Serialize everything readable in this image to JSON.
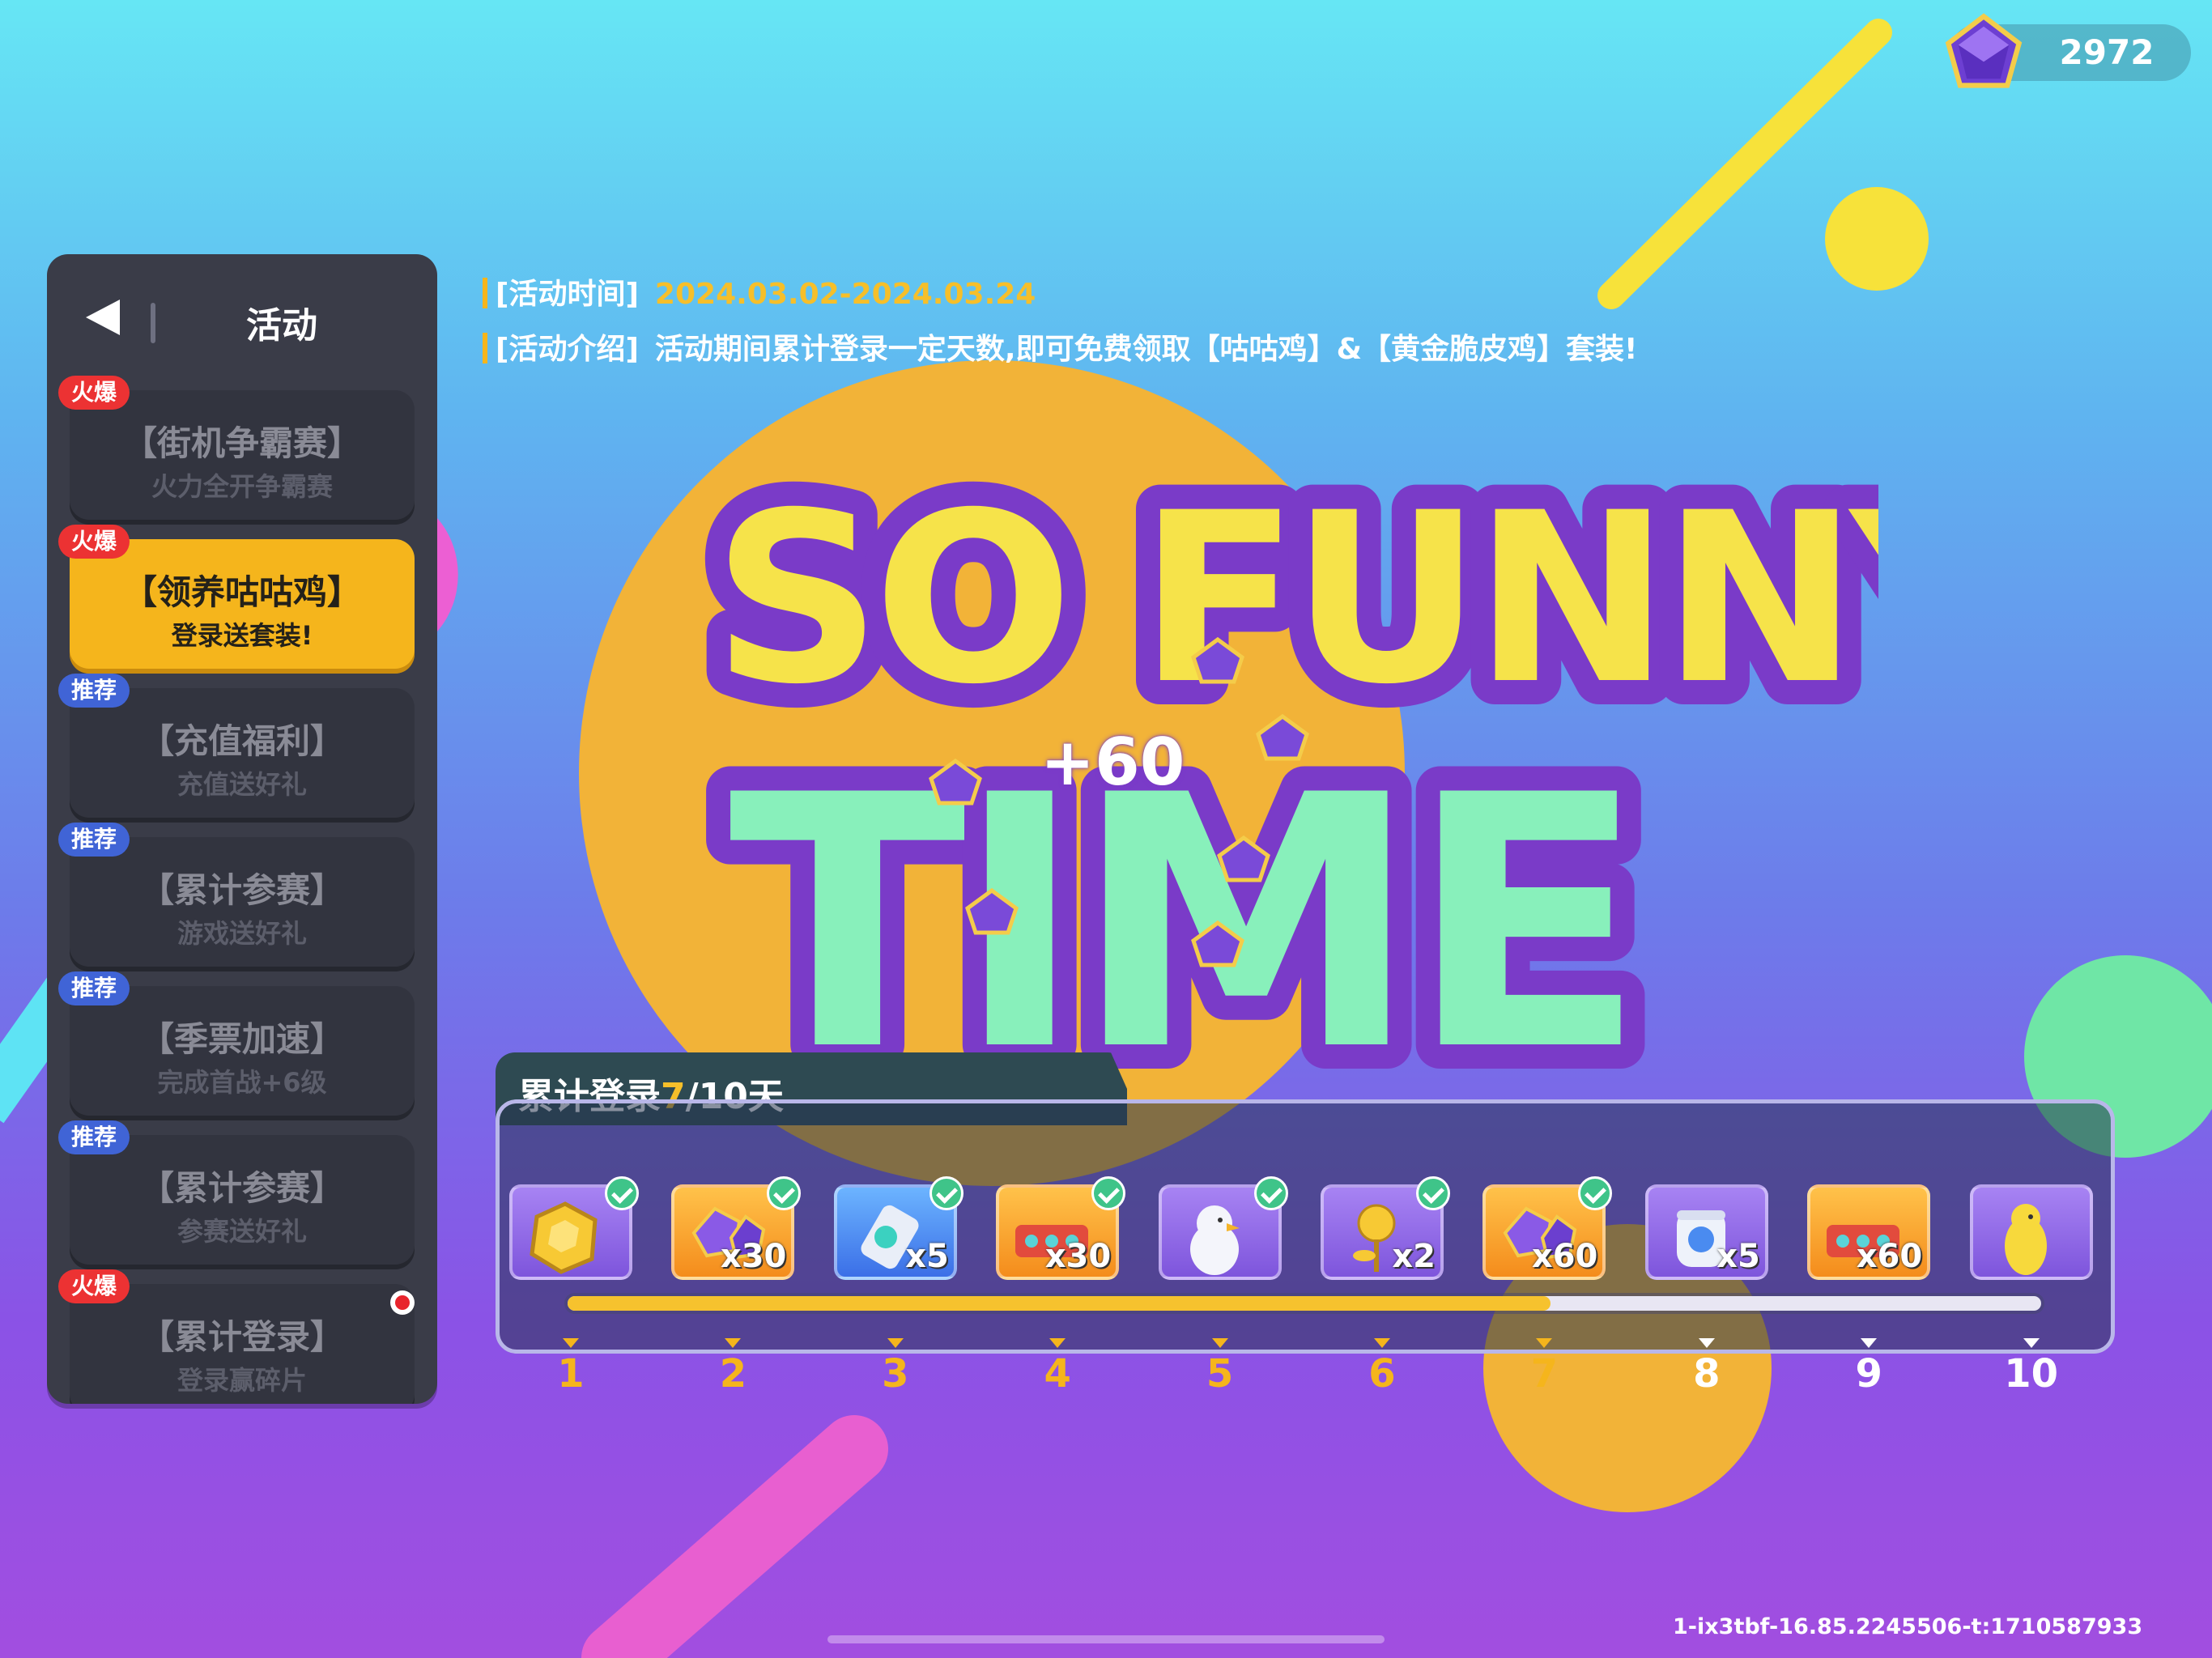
{
  "currency": {
    "icon": "purple-gem-icon",
    "amount": "2972"
  },
  "sidebar": {
    "title": "活动",
    "items": [
      {
        "badge": "火爆",
        "badge_type": "hot",
        "title": "【街机争霸赛】",
        "subtitle": "火力全开争霸赛",
        "active": false
      },
      {
        "badge": "火爆",
        "badge_type": "hot",
        "title": "【领养咕咕鸡】",
        "subtitle": "登录送套装!",
        "active": true
      },
      {
        "badge": "推荐",
        "badge_type": "rec",
        "title": "【充值福利】",
        "subtitle": "充值送好礼",
        "active": false
      },
      {
        "badge": "推荐",
        "badge_type": "rec",
        "title": "【累计参赛】",
        "subtitle": "游戏送好礼",
        "active": false
      },
      {
        "badge": "推荐",
        "badge_type": "rec",
        "title": "【季票加速】",
        "subtitle": "完成首战+6级",
        "active": false
      },
      {
        "badge": "推荐",
        "badge_type": "rec",
        "title": "【累计参赛】",
        "subtitle": "参赛送好礼",
        "active": false
      },
      {
        "badge": "火爆",
        "badge_type": "hot",
        "title": "【累计登录】",
        "subtitle": "登录赢碎片",
        "active": false
      }
    ]
  },
  "event": {
    "time_label": "[活动时间]",
    "time_value": "2024.03.02-2024.03.24",
    "intro_label": "[活动介绍]",
    "intro_value": "活动期间累计登录一定天数,即可免费领取【咕咕鸡】&【黄金脆皮鸡】套装!"
  },
  "banner": {
    "line1": "SO FUNNY",
    "line2": "TIME",
    "popup": "+60"
  },
  "progress": {
    "title_prefix": "累计登录",
    "current": "7",
    "title_suffix": "/10天",
    "fraction": 0.667,
    "rewards": [
      {
        "day": "1",
        "icon": "gold-coin-icon",
        "qty": "",
        "style": "purple",
        "claimed": true
      },
      {
        "day": "2",
        "icon": "purple-gem-pile-icon",
        "qty": "x30",
        "style": "orange",
        "claimed": true
      },
      {
        "day": "3",
        "icon": "paint-tube-icon",
        "qty": "x5",
        "style": "blue",
        "claimed": true
      },
      {
        "day": "4",
        "icon": "ticket-pile-icon",
        "qty": "x30",
        "style": "orange",
        "claimed": true
      },
      {
        "day": "5",
        "icon": "white-chicken-icon",
        "qty": "",
        "style": "purple",
        "claimed": true
      },
      {
        "day": "6",
        "icon": "golden-rose-icon",
        "qty": "x2",
        "style": "purple",
        "claimed": true
      },
      {
        "day": "7",
        "icon": "purple-gem-pile-icon",
        "qty": "x60",
        "style": "orange",
        "claimed": true
      },
      {
        "day": "8",
        "icon": "paint-jar-icon",
        "qty": "x5",
        "style": "purple",
        "claimed": false
      },
      {
        "day": "9",
        "icon": "ticket-pile-icon",
        "qty": "x60",
        "style": "orange",
        "claimed": false
      },
      {
        "day": "10",
        "icon": "golden-chicken-icon",
        "qty": "",
        "style": "purple",
        "claimed": false
      }
    ]
  },
  "footer": {
    "build_info": "1-ix3tbf-16.85.2245506-t:1710587933"
  },
  "colors": {
    "accent": "#f5b51c",
    "panel_border": "#b9b7e9",
    "hot_badge": "#ec3233",
    "rec_badge": "#4064d6"
  }
}
